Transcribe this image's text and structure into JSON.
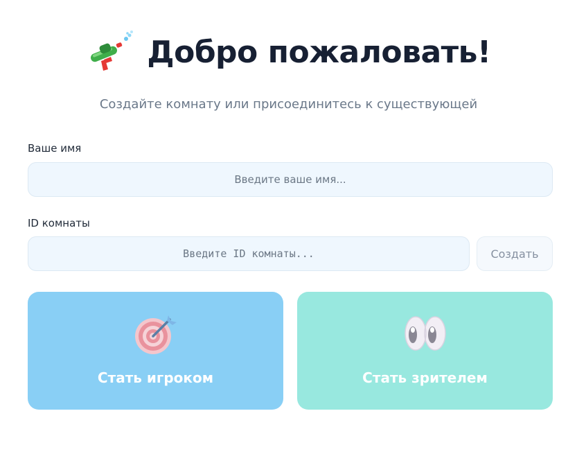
{
  "header": {
    "icon": "water-gun-icon",
    "title": "Добро пожаловать!",
    "subtitle": "Создайте комнату или присоединитесь к существующей"
  },
  "form": {
    "name_label": "Ваше имя",
    "name_placeholder": "Введите ваше имя...",
    "room_label": "ID комнаты",
    "room_placeholder": "Введите ID комнаты...",
    "create_label": "Создать"
  },
  "roles": {
    "player": {
      "icon": "target-icon",
      "label": "Стать игроком",
      "color": "#89cff5"
    },
    "viewer": {
      "icon": "eyes-icon",
      "label": "Стать зрителем",
      "color": "#98e8df"
    }
  }
}
